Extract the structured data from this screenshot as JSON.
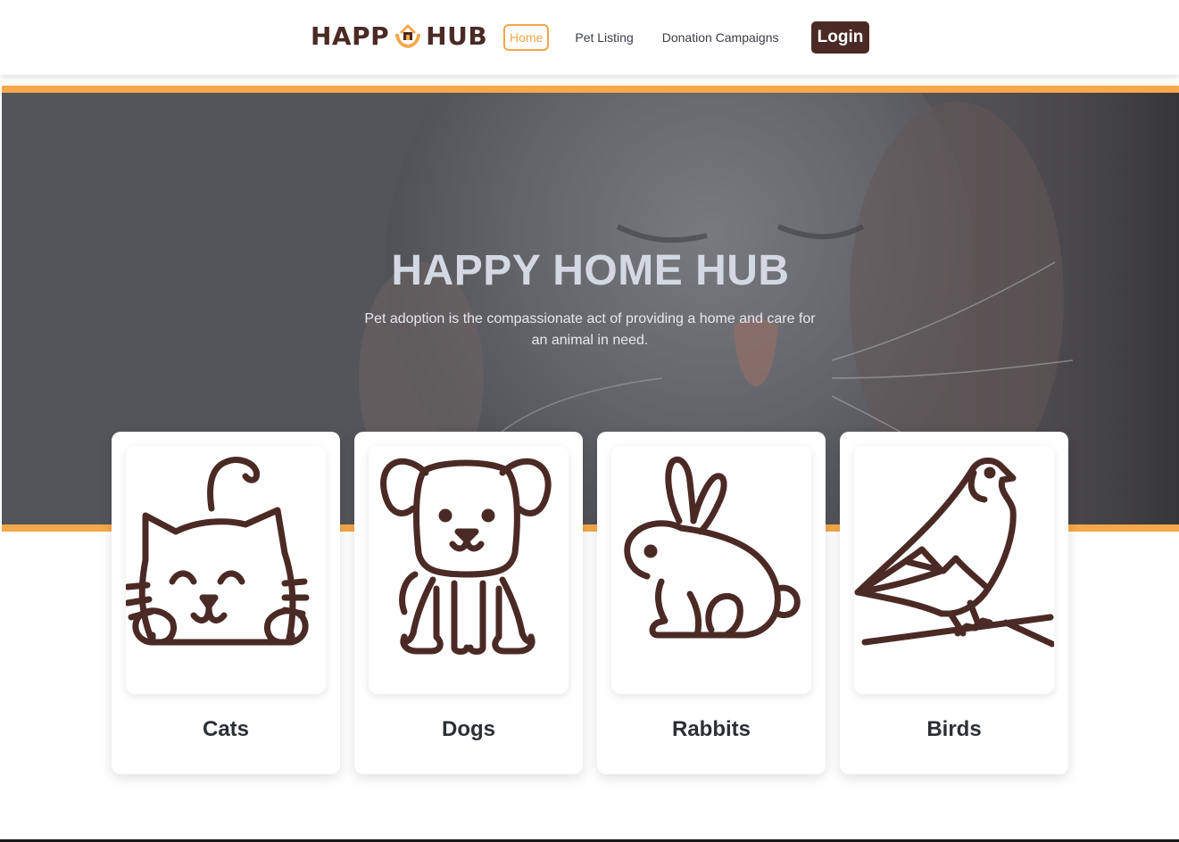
{
  "header": {
    "brand": {
      "left_text": "HAPP",
      "right_text": "HUB"
    },
    "nav": [
      {
        "label": "Home",
        "active": true
      },
      {
        "label": "Pet Listing",
        "active": false
      },
      {
        "label": "Donation Campaigns",
        "active": false
      }
    ],
    "login_label": "Login"
  },
  "hero": {
    "title": "HAPPY HOME HUB",
    "subtitle": "Pet adoption is the compassionate act of providing a home and care for an animal in need."
  },
  "categories": [
    {
      "label": "Cats",
      "icon": "cat-icon"
    },
    {
      "label": "Dogs",
      "icon": "dog-icon"
    },
    {
      "label": "Rabbits",
      "icon": "rabbit-icon"
    },
    {
      "label": "Birds",
      "icon": "bird-icon"
    }
  ],
  "colors": {
    "brand_brown": "#4b2a26",
    "accent_orange": "#f6a84a",
    "hero_overlay": "#5b5d63",
    "title_text": "#2b2f36"
  }
}
